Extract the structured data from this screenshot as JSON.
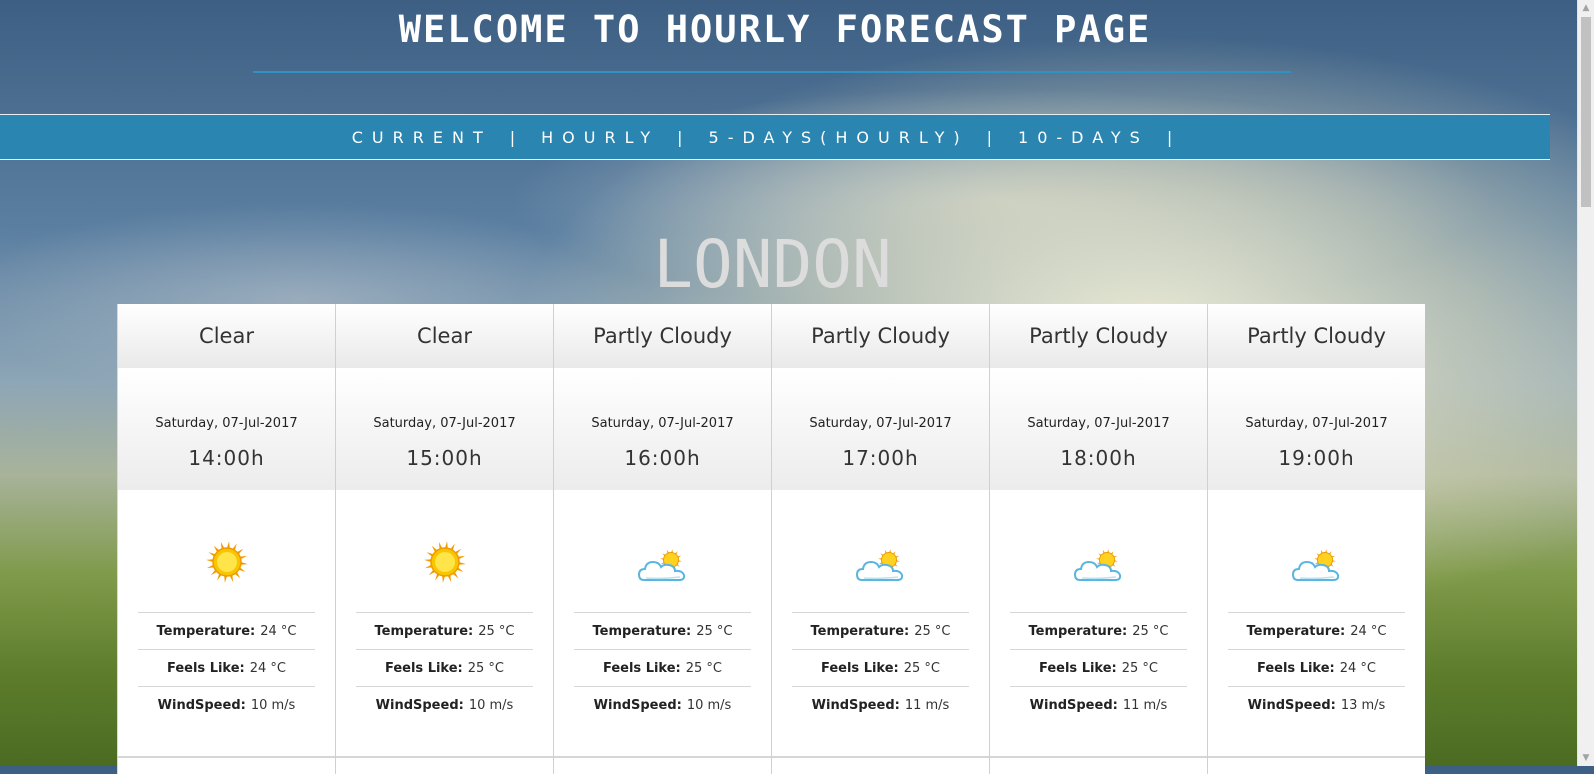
{
  "header": {
    "title": "WELCOME TO HOURLY FORECAST PAGE"
  },
  "nav": {
    "items": [
      {
        "label": "CURRENT"
      },
      {
        "label": "HOURLY"
      },
      {
        "label": "5-DAYS(HOURLY)"
      },
      {
        "label": "10-DAYS"
      }
    ],
    "separator": "|"
  },
  "city": "LONDON",
  "labels": {
    "temperature": "Temperature:",
    "feels_like": "Feels Like:",
    "windspeed": "WindSpeed:"
  },
  "forecast": [
    {
      "condition": "Clear",
      "date": "Saturday, 07-Jul-2017",
      "time": "14:00h",
      "icon": "sun-icon",
      "temperature": "24 °C",
      "feels_like": "24 °C",
      "windspeed": "10 m/s"
    },
    {
      "condition": "Clear",
      "date": "Saturday, 07-Jul-2017",
      "time": "15:00h",
      "icon": "sun-icon",
      "temperature": "25 °C",
      "feels_like": "25 °C",
      "windspeed": "10 m/s"
    },
    {
      "condition": "Partly Cloudy",
      "date": "Saturday, 07-Jul-2017",
      "time": "16:00h",
      "icon": "partly-cloudy-icon",
      "temperature": "25 °C",
      "feels_like": "25 °C",
      "windspeed": "10 m/s"
    },
    {
      "condition": "Partly Cloudy",
      "date": "Saturday, 07-Jul-2017",
      "time": "17:00h",
      "icon": "partly-cloudy-icon",
      "temperature": "25 °C",
      "feels_like": "25 °C",
      "windspeed": "11 m/s"
    },
    {
      "condition": "Partly Cloudy",
      "date": "Saturday, 07-Jul-2017",
      "time": "18:00h",
      "icon": "partly-cloudy-icon",
      "temperature": "25 °C",
      "feels_like": "25 °C",
      "windspeed": "11 m/s"
    },
    {
      "condition": "Partly Cloudy",
      "date": "Saturday, 07-Jul-2017",
      "time": "19:00h",
      "icon": "partly-cloudy-icon",
      "temperature": "24 °C",
      "feels_like": "24 °C",
      "windspeed": "13 m/s"
    }
  ],
  "colors": {
    "nav_bg": "#2a86b1",
    "rule": "#2e93c2",
    "sun": "#f5b800",
    "cloud": "#7cc7e8"
  }
}
